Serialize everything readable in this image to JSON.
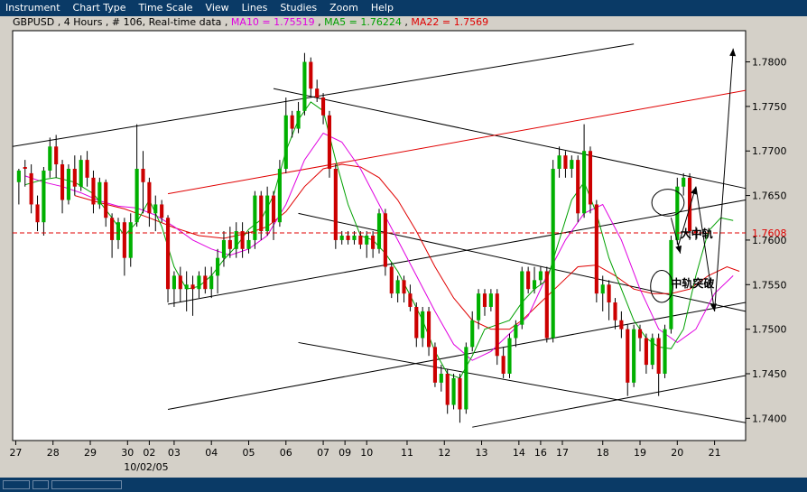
{
  "menu": [
    "Instrument",
    "Chart Type",
    "Time Scale",
    "View",
    "Lines",
    "Studies",
    "Zoom",
    "Help"
  ],
  "info": {
    "prefix": "GBPUSD , 4 Hours , # 106, Real-time data",
    "ma10": "MA10 = 1.75519",
    "ma5": "MA5 = 1.76224",
    "ma22": "MA22 = 1.7569"
  },
  "colors": {
    "background": "#d4d0c8",
    "plot": "#ffffff",
    "bar": "#0a3a66",
    "up": "#00b000",
    "down": "#cc0000",
    "ma10": "#e000e0",
    "ma5": "#00a000",
    "ma22": "#e00000",
    "trend": "#000000",
    "trend_red": "#e00000"
  },
  "chart_data": {
    "type": "candlestick",
    "instrument": "GBPUSD",
    "timeframe": "4 Hours",
    "ylim": [
      1.7375,
      1.7835
    ],
    "yticks": [
      1.74,
      1.745,
      1.75,
      1.755,
      1.76,
      1.765,
      1.77,
      1.775,
      1.78
    ],
    "ytick_labels": [
      "1.7400",
      "1.7450",
      "1.7500",
      "1.7550",
      "1.7600",
      "1.7650",
      "1.7700",
      "1.7750",
      "1.7800"
    ],
    "current_price": 1.7608,
    "current_price_label": "1.7608",
    "x_range": [
      0,
      118
    ],
    "xticks": [
      {
        "x": 0.5,
        "label": "27"
      },
      {
        "x": 6.5,
        "label": "28"
      },
      {
        "x": 12.5,
        "label": "29"
      },
      {
        "x": 18.5,
        "label": "30"
      },
      {
        "x": 22,
        "label": "02"
      },
      {
        "x": 26,
        "label": "03"
      },
      {
        "x": 32,
        "label": "04"
      },
      {
        "x": 38,
        "label": "05"
      },
      {
        "x": 44,
        "label": "06"
      },
      {
        "x": 50,
        "label": "07"
      },
      {
        "x": 53.5,
        "label": "09"
      },
      {
        "x": 57,
        "label": "10"
      },
      {
        "x": 63.5,
        "label": "11"
      },
      {
        "x": 69.5,
        "label": "12"
      },
      {
        "x": 75.5,
        "label": "13"
      },
      {
        "x": 81.5,
        "label": "14"
      },
      {
        "x": 85,
        "label": "16"
      },
      {
        "x": 88.5,
        "label": "17"
      },
      {
        "x": 95,
        "label": "18"
      },
      {
        "x": 101,
        "label": "19"
      },
      {
        "x": 107,
        "label": "20"
      },
      {
        "x": 113,
        "label": "21"
      }
    ],
    "date_label": {
      "x": 21.5,
      "label": "10/02/05"
    },
    "candles": [
      [
        1.7665,
        1.7678,
        1.764,
        1.768
      ],
      [
        1.7682,
        1.768,
        1.766,
        1.769
      ],
      [
        1.7675,
        1.764,
        1.763,
        1.7685
      ],
      [
        1.764,
        1.762,
        1.761,
        1.765
      ],
      [
        1.762,
        1.7678,
        1.7605,
        1.7682
      ],
      [
        1.7678,
        1.7705,
        1.767,
        1.7715
      ],
      [
        1.7705,
        1.7685,
        1.767,
        1.7718
      ],
      [
        1.7685,
        1.7645,
        1.763,
        1.769
      ],
      [
        1.7645,
        1.768,
        1.764,
        1.7685
      ],
      [
        1.768,
        1.766,
        1.765,
        1.7695
      ],
      [
        1.766,
        1.769,
        1.7655,
        1.7695
      ],
      [
        1.769,
        1.767,
        1.766,
        1.77
      ],
      [
        1.767,
        1.764,
        1.763,
        1.7678
      ],
      [
        1.764,
        1.7665,
        1.7635,
        1.767
      ],
      [
        1.7665,
        1.7625,
        1.7615,
        1.7668
      ],
      [
        1.7625,
        1.76,
        1.758,
        1.763
      ],
      [
        1.76,
        1.762,
        1.759,
        1.7625
      ],
      [
        1.762,
        1.758,
        1.756,
        1.7625
      ],
      [
        1.758,
        1.762,
        1.757,
        1.763
      ],
      [
        1.762,
        1.768,
        1.7615,
        1.773
      ],
      [
        1.768,
        1.7665,
        1.763,
        1.77
      ],
      [
        1.7665,
        1.763,
        1.7615,
        1.767
      ],
      [
        1.763,
        1.764,
        1.761,
        1.765
      ],
      [
        1.764,
        1.7625,
        1.762,
        1.7645
      ],
      [
        1.7625,
        1.7545,
        1.753,
        1.7628
      ],
      [
        1.7545,
        1.756,
        1.7525,
        1.7565
      ],
      [
        1.756,
        1.7545,
        1.753,
        1.757
      ],
      [
        1.7545,
        1.755,
        1.752,
        1.7565
      ],
      [
        1.755,
        1.7545,
        1.7515,
        1.756
      ],
      [
        1.7545,
        1.756,
        1.7535,
        1.7565
      ],
      [
        1.756,
        1.7545,
        1.754,
        1.757
      ],
      [
        1.7545,
        1.756,
        1.7535,
        1.757
      ],
      [
        1.756,
        1.758,
        1.754,
        1.759
      ],
      [
        1.758,
        1.76,
        1.757,
        1.761
      ],
      [
        1.76,
        1.759,
        1.758,
        1.7615
      ],
      [
        1.759,
        1.761,
        1.758,
        1.762
      ],
      [
        1.761,
        1.759,
        1.758,
        1.762
      ],
      [
        1.759,
        1.76,
        1.7585,
        1.761
      ],
      [
        1.76,
        1.765,
        1.759,
        1.7655
      ],
      [
        1.765,
        1.761,
        1.76,
        1.7655
      ],
      [
        1.761,
        1.765,
        1.7605,
        1.766
      ],
      [
        1.765,
        1.762,
        1.76,
        1.7655
      ],
      [
        1.762,
        1.768,
        1.7615,
        1.769
      ],
      [
        1.768,
        1.774,
        1.7675,
        1.776
      ],
      [
        1.774,
        1.7725,
        1.7715,
        1.7745
      ],
      [
        1.7725,
        1.7745,
        1.772,
        1.7755
      ],
      [
        1.7745,
        1.78,
        1.774,
        1.781
      ],
      [
        1.78,
        1.777,
        1.776,
        1.7805
      ],
      [
        1.777,
        1.776,
        1.7755,
        1.778
      ],
      [
        1.776,
        1.774,
        1.773,
        1.7765
      ],
      [
        1.774,
        1.768,
        1.767,
        1.7745
      ],
      [
        1.768,
        1.76,
        1.759,
        1.7685
      ],
      [
        1.76,
        1.7605,
        1.7595,
        1.761
      ],
      [
        1.7605,
        1.76,
        1.7595,
        1.761
      ],
      [
        1.76,
        1.7605,
        1.7595,
        1.761
      ],
      [
        1.7605,
        1.7595,
        1.759,
        1.761
      ],
      [
        1.7595,
        1.7605,
        1.758,
        1.761
      ],
      [
        1.7605,
        1.759,
        1.758,
        1.761
      ],
      [
        1.759,
        1.763,
        1.7585,
        1.7635
      ],
      [
        1.763,
        1.757,
        1.756,
        1.7635
      ],
      [
        1.757,
        1.754,
        1.7535,
        1.7575
      ],
      [
        1.754,
        1.7555,
        1.753,
        1.756
      ],
      [
        1.7555,
        1.754,
        1.753,
        1.756
      ],
      [
        1.754,
        1.7525,
        1.752,
        1.755
      ],
      [
        1.7525,
        1.749,
        1.748,
        1.753
      ],
      [
        1.749,
        1.752,
        1.748,
        1.7525
      ],
      [
        1.752,
        1.748,
        1.747,
        1.7525
      ],
      [
        1.748,
        1.744,
        1.7435,
        1.7485
      ],
      [
        1.744,
        1.745,
        1.743,
        1.746
      ],
      [
        1.745,
        1.7415,
        1.7405,
        1.7455
      ],
      [
        1.7415,
        1.7445,
        1.741,
        1.745
      ],
      [
        1.7445,
        1.741,
        1.7395,
        1.745
      ],
      [
        1.741,
        1.748,
        1.7405,
        1.7485
      ],
      [
        1.748,
        1.751,
        1.7475,
        1.752
      ],
      [
        1.751,
        1.754,
        1.75,
        1.7545
      ],
      [
        1.754,
        1.7525,
        1.7515,
        1.7545
      ],
      [
        1.7525,
        1.754,
        1.752,
        1.7545
      ],
      [
        1.754,
        1.747,
        1.746,
        1.7545
      ],
      [
        1.747,
        1.745,
        1.7445,
        1.748
      ],
      [
        1.745,
        1.749,
        1.7445,
        1.7495
      ],
      [
        1.749,
        1.7505,
        1.748,
        1.751
      ],
      [
        1.7505,
        1.7565,
        1.75,
        1.757
      ],
      [
        1.7565,
        1.7545,
        1.754,
        1.757
      ],
      [
        1.7545,
        1.7555,
        1.754,
        1.757
      ],
      [
        1.7555,
        1.7565,
        1.755,
        1.757
      ],
      [
        1.7565,
        1.749,
        1.7485,
        1.757
      ],
      [
        1.749,
        1.768,
        1.7485,
        1.769
      ],
      [
        1.768,
        1.7695,
        1.767,
        1.7705
      ],
      [
        1.7695,
        1.768,
        1.767,
        1.77
      ],
      [
        1.768,
        1.769,
        1.767,
        1.7695
      ],
      [
        1.769,
        1.763,
        1.762,
        1.7695
      ],
      [
        1.763,
        1.77,
        1.7625,
        1.773
      ],
      [
        1.77,
        1.764,
        1.763,
        1.7705
      ],
      [
        1.764,
        1.754,
        1.753,
        1.7645
      ],
      [
        1.754,
        1.755,
        1.752,
        1.756
      ],
      [
        1.755,
        1.753,
        1.751,
        1.7555
      ],
      [
        1.753,
        1.751,
        1.75,
        1.7535
      ],
      [
        1.751,
        1.75,
        1.749,
        1.752
      ],
      [
        1.75,
        1.744,
        1.7425,
        1.7505
      ],
      [
        1.744,
        1.75,
        1.7435,
        1.7505
      ],
      [
        1.75,
        1.749,
        1.7475,
        1.7505
      ],
      [
        1.749,
        1.746,
        1.745,
        1.7495
      ],
      [
        1.746,
        1.749,
        1.7455,
        1.7495
      ],
      [
        1.749,
        1.745,
        1.7425,
        1.7495
      ],
      [
        1.745,
        1.75,
        1.7445,
        1.7505
      ],
      [
        1.75,
        1.76,
        1.7495,
        1.7605
      ],
      [
        1.76,
        1.766,
        1.7595,
        1.767
      ],
      [
        1.766,
        1.767,
        1.765,
        1.7675
      ],
      [
        1.767,
        1.761,
        1.76,
        1.7675
      ],
      [
        1.761,
        1.7608,
        1.76,
        1.7615
      ]
    ],
    "ma5": [
      [
        2,
        1.7662
      ],
      [
        5,
        1.7668
      ],
      [
        7,
        1.767
      ],
      [
        10,
        1.7665
      ],
      [
        13,
        1.7652
      ],
      [
        16,
        1.7625
      ],
      [
        18,
        1.7605
      ],
      [
        20,
        1.762
      ],
      [
        22,
        1.7645
      ],
      [
        24,
        1.7615
      ],
      [
        26,
        1.757
      ],
      [
        28,
        1.7545
      ],
      [
        30,
        1.7548
      ],
      [
        32,
        1.756
      ],
      [
        34,
        1.7578
      ],
      [
        36,
        1.7593
      ],
      [
        38,
        1.7612
      ],
      [
        40,
        1.7623
      ],
      [
        42,
        1.765
      ],
      [
        44,
        1.77
      ],
      [
        46,
        1.7735
      ],
      [
        48,
        1.7755
      ],
      [
        50,
        1.7745
      ],
      [
        52,
        1.769
      ],
      [
        54,
        1.764
      ],
      [
        56,
        1.7605
      ],
      [
        58,
        1.76
      ],
      [
        60,
        1.7585
      ],
      [
        62,
        1.7565
      ],
      [
        64,
        1.7538
      ],
      [
        66,
        1.751
      ],
      [
        68,
        1.7475
      ],
      [
        70,
        1.745
      ],
      [
        72,
        1.7445
      ],
      [
        74,
        1.747
      ],
      [
        76,
        1.75
      ],
      [
        78,
        1.7505
      ],
      [
        80,
        1.751
      ],
      [
        82,
        1.753
      ],
      [
        84,
        1.7545
      ],
      [
        86,
        1.7555
      ],
      [
        88,
        1.76
      ],
      [
        90,
        1.7645
      ],
      [
        92,
        1.7665
      ],
      [
        94,
        1.763
      ],
      [
        96,
        1.758
      ],
      [
        98,
        1.7545
      ],
      [
        100,
        1.751
      ],
      [
        102,
        1.749
      ],
      [
        104,
        1.748
      ],
      [
        106,
        1.7478
      ],
      [
        108,
        1.75
      ],
      [
        110,
        1.756
      ],
      [
        112,
        1.761
      ],
      [
        114,
        1.7625
      ],
      [
        116,
        1.7622
      ]
    ],
    "ma10": [
      [
        2,
        1.7672
      ],
      [
        5,
        1.7665
      ],
      [
        8,
        1.766
      ],
      [
        11,
        1.7653
      ],
      [
        14,
        1.7644
      ],
      [
        17,
        1.7638
      ],
      [
        20,
        1.7636
      ],
      [
        23,
        1.7628
      ],
      [
        26,
        1.7615
      ],
      [
        29,
        1.76
      ],
      [
        32,
        1.759
      ],
      [
        35,
        1.7583
      ],
      [
        38,
        1.759
      ],
      [
        41,
        1.7605
      ],
      [
        44,
        1.764
      ],
      [
        47,
        1.769
      ],
      [
        50,
        1.772
      ],
      [
        53,
        1.771
      ],
      [
        56,
        1.768
      ],
      [
        59,
        1.764
      ],
      [
        62,
        1.76
      ],
      [
        65,
        1.756
      ],
      [
        68,
        1.752
      ],
      [
        71,
        1.7483
      ],
      [
        74,
        1.7465
      ],
      [
        77,
        1.7475
      ],
      [
        80,
        1.7495
      ],
      [
        83,
        1.7515
      ],
      [
        86,
        1.756
      ],
      [
        89,
        1.76
      ],
      [
        92,
        1.763
      ],
      [
        95,
        1.764
      ],
      [
        98,
        1.76
      ],
      [
        101,
        1.7545
      ],
      [
        104,
        1.75
      ],
      [
        107,
        1.7485
      ],
      [
        110,
        1.75
      ],
      [
        113,
        1.754
      ],
      [
        116,
        1.756
      ]
    ],
    "ma22": [
      [
        10,
        1.765
      ],
      [
        14,
        1.7642
      ],
      [
        18,
        1.7635
      ],
      [
        22,
        1.7625
      ],
      [
        26,
        1.7614
      ],
      [
        30,
        1.7605
      ],
      [
        34,
        1.7602
      ],
      [
        38,
        1.7608
      ],
      [
        41,
        1.7615
      ],
      [
        44,
        1.7632
      ],
      [
        47,
        1.766
      ],
      [
        50,
        1.768
      ],
      [
        53,
        1.7685
      ],
      [
        56,
        1.7682
      ],
      [
        59,
        1.767
      ],
      [
        62,
        1.7645
      ],
      [
        65,
        1.761
      ],
      [
        68,
        1.757
      ],
      [
        71,
        1.7535
      ],
      [
        74,
        1.751
      ],
      [
        77,
        1.75
      ],
      [
        80,
        1.75
      ],
      [
        82,
        1.751
      ],
      [
        85,
        1.753
      ],
      [
        88,
        1.755
      ],
      [
        91,
        1.757
      ],
      [
        94,
        1.7572
      ],
      [
        97,
        1.756
      ],
      [
        100,
        1.7545
      ],
      [
        103,
        1.754
      ],
      [
        106,
        1.754
      ],
      [
        109,
        1.7545
      ],
      [
        112,
        1.756
      ],
      [
        115,
        1.757
      ],
      [
        117,
        1.7565
      ]
    ],
    "trend_lines": [
      {
        "from": [
          0,
          1.7705
        ],
        "to": [
          100,
          1.782
        ],
        "color": "black"
      },
      {
        "from": [
          42,
          1.777
        ],
        "to": [
          118,
          1.7658
        ],
        "color": "black"
      },
      {
        "from": [
          25,
          1.7652
        ],
        "to": [
          118,
          1.7768
        ],
        "color": "red"
      },
      {
        "from": [
          25,
          1.7528
        ],
        "to": [
          118,
          1.7645
        ],
        "color": "black"
      },
      {
        "from": [
          46,
          1.763
        ],
        "to": [
          118,
          1.752
        ],
        "color": "black"
      },
      {
        "from": [
          25,
          1.741
        ],
        "to": [
          118,
          1.753
        ],
        "color": "black"
      },
      {
        "from": [
          46,
          1.7485
        ],
        "to": [
          118,
          1.7395
        ],
        "color": "black"
      },
      {
        "from": [
          74,
          1.739
        ],
        "to": [
          118,
          1.7448
        ],
        "color": "black"
      }
    ],
    "ellipses": [
      {
        "cx": 105.5,
        "cy": 1.7642,
        "rx": 2.6,
        "ry": 0.0015
      },
      {
        "cx": 104.5,
        "cy": 1.7548,
        "rx": 1.8,
        "ry": 0.0018
      }
    ],
    "arrows": [
      {
        "from": [
          107,
          1.759
        ],
        "to": [
          110,
          1.766
        ]
      },
      {
        "from": [
          110,
          1.766
        ],
        "to": [
          113,
          1.752
        ]
      },
      {
        "from": [
          113,
          1.752
        ],
        "to": [
          116,
          1.7815
        ]
      },
      {
        "from": [
          106,
          1.7625
        ],
        "to": [
          107.5,
          1.7585
        ]
      }
    ],
    "annotations": [
      {
        "x": 107.5,
        "y": 1.7603,
        "text": "大中轨"
      },
      {
        "x": 106,
        "y": 1.7547,
        "text": "中轨突破"
      }
    ]
  }
}
